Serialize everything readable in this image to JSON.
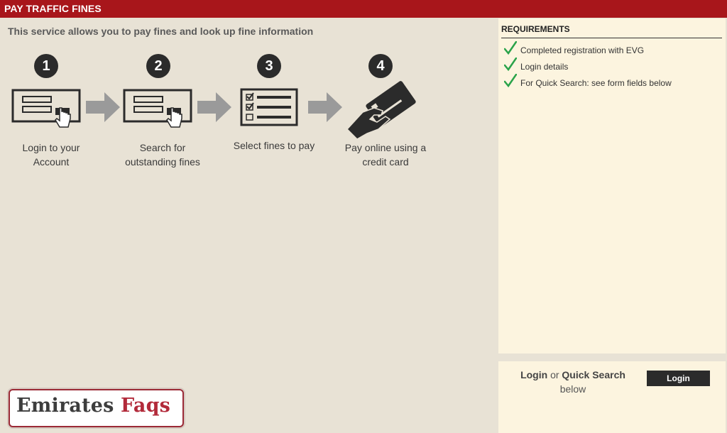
{
  "header": {
    "title": "PAY TRAFFIC FINES"
  },
  "intro": "This service allows you to pay fines and look up fine information",
  "steps": [
    {
      "number": "1",
      "label_line1": "Login to your",
      "label_line2": "Account",
      "icon": "login-form-icon"
    },
    {
      "number": "2",
      "label_line1": "Search for",
      "label_line2": "outstanding fines",
      "icon": "search-form-icon"
    },
    {
      "number": "3",
      "label_line1": "Select fines to pay",
      "label_line2": "",
      "icon": "checklist-icon"
    },
    {
      "number": "4",
      "label_line1": "Pay online using a",
      "label_line2": "credit card",
      "icon": "credit-card-hand-icon"
    }
  ],
  "requirements": {
    "title": "REQUIREMENTS",
    "items": [
      "Completed registration with EVG",
      "Login details",
      "For Quick Search: see form fields below"
    ]
  },
  "login_panel": {
    "login_word": "Login",
    "or_word": "or",
    "quick_search_word": "Quick Search",
    "below_word": "below",
    "button_label": "Login"
  },
  "brand": {
    "word1": "Emirates",
    "word2": "Faqs"
  },
  "colors": {
    "header_bg": "#a8161b",
    "check": "#2aa34a",
    "brand_accent": "#b22a3a"
  }
}
